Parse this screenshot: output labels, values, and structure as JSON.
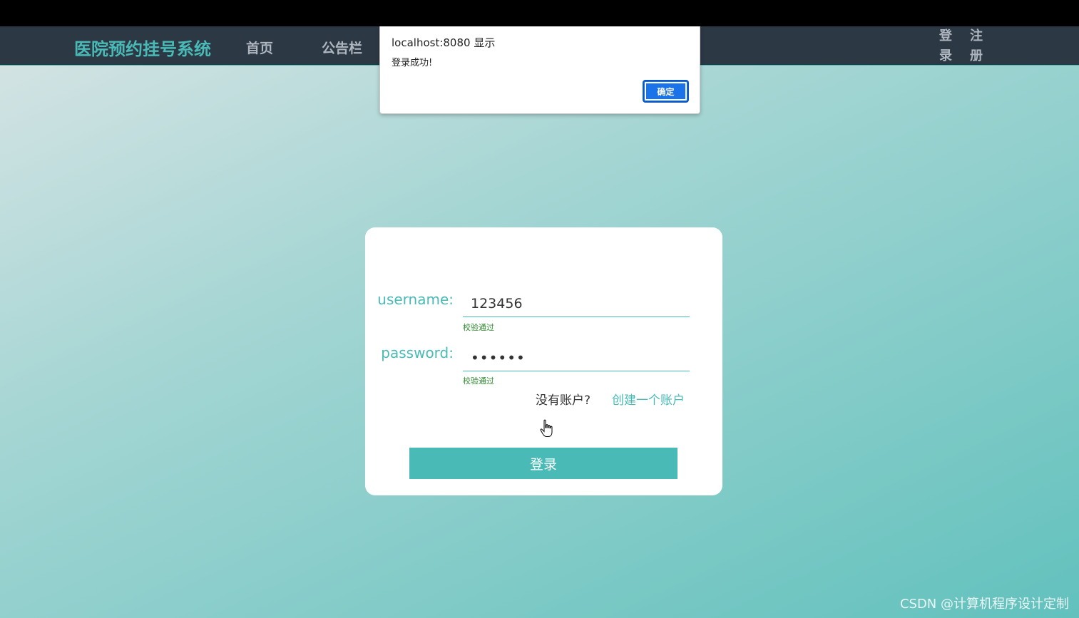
{
  "navbar": {
    "brand": "医院预约挂号系统",
    "links": [
      "首页",
      "公告栏"
    ],
    "login_chars": [
      "登",
      "录"
    ],
    "register_chars": [
      "注",
      "册"
    ]
  },
  "dialog": {
    "title": "localhost:8080 显示",
    "message": "登录成功!",
    "ok_label": "确定"
  },
  "form": {
    "username_label": "username:",
    "username_value": "123456",
    "username_hint": "校验通过",
    "password_label": "password:",
    "password_value": "••••••",
    "password_hint": "校验通过",
    "no_account_text": "没有账户?",
    "create_account_link": "创建一个账户",
    "login_button": "登录"
  },
  "watermark": "CSDN @计算机程序设计定制",
  "colors": {
    "accent": "#49bab6",
    "navbar_bg": "#2d3845",
    "dialog_button": "#1a73e8",
    "valid_hint": "#2e8b2e"
  }
}
